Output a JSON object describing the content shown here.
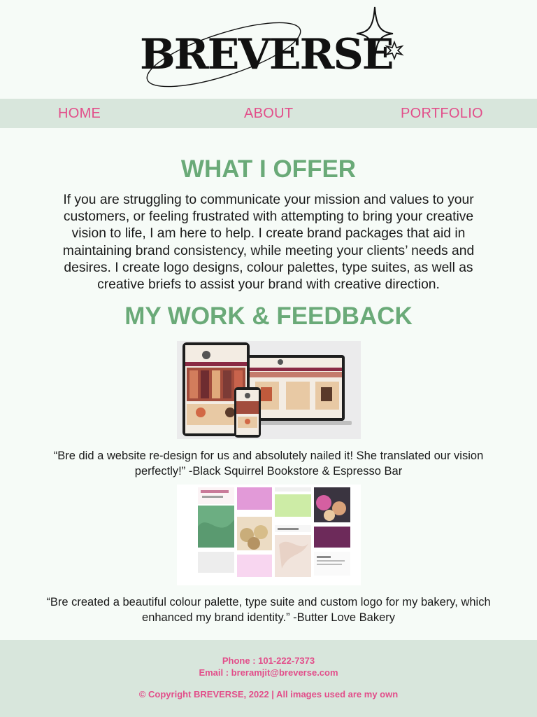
{
  "brand": {
    "logo_text": "BREVERSE"
  },
  "nav": {
    "home": "HOME",
    "about": "ABOUT",
    "portfolio": "PORTFOLIO"
  },
  "offer": {
    "title": "WHAT I OFFER",
    "body": "If you are struggling to communicate your mission and values to your customers, or feeling frustrated with attempting to bring your creative vision to life, I am here to help. I create brand packages that aid in maintaining brand consistency, while meeting your clients’ needs and desires. I create logo designs, colour palettes, type suites, as well as creative briefs to assist your brand with creative direction."
  },
  "work": {
    "title": "MY WORK & FEEDBACK",
    "quote1": "“Bre did a website re-design for us and absolutely nailed it! She translated our vision perfectly!” -Black Squirrel Bookstore & Espresso Bar",
    "quote2": "“Bre created a beautiful colour palette, type suite and custom logo for my bakery, which enhanced my brand identity.” -Butter Love Bakery"
  },
  "footer": {
    "phone": "Phone : 101-222-7373",
    "email": "Email : breramjit@breverse.com",
    "copyright": "© Copyright BREVERSE, 2022 | All images used are my own"
  },
  "colors": {
    "accent_pink": "#e24e8a",
    "heading_green": "#6aaa78",
    "band_green": "#d8e6dc",
    "background": "#f6fbf7"
  }
}
